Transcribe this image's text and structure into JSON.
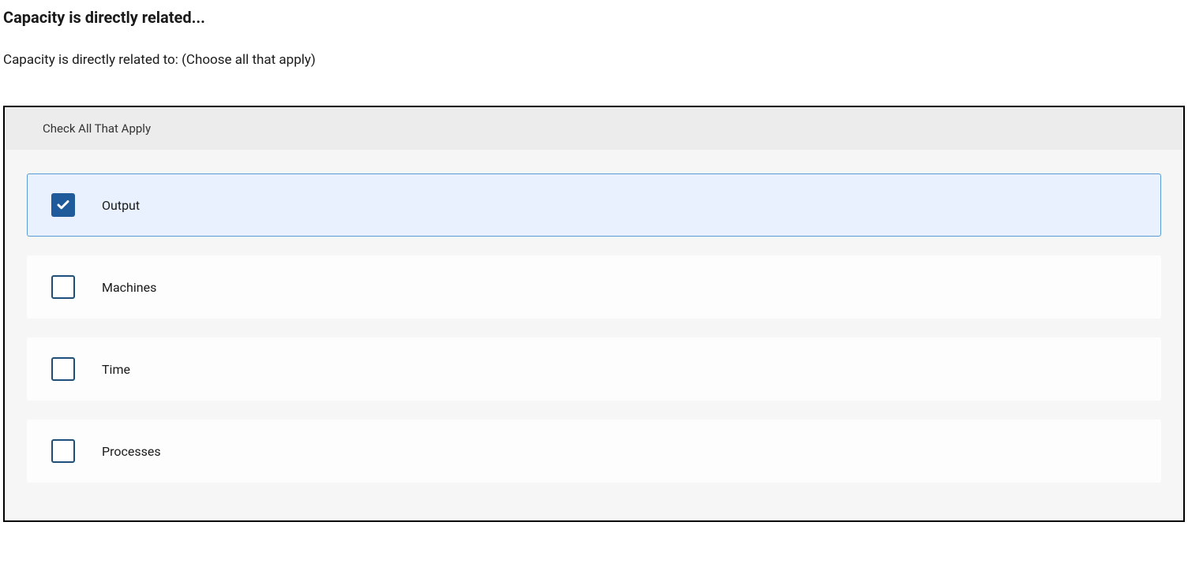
{
  "question": {
    "title": "Capacity is directly related...",
    "prompt": "Capacity is directly related to: (Choose all that apply)"
  },
  "panel": {
    "header": "Check All That Apply"
  },
  "options": [
    {
      "label": "Output",
      "checked": true
    },
    {
      "label": "Machines",
      "checked": false
    },
    {
      "label": "Time",
      "checked": false
    },
    {
      "label": "Processes",
      "checked": false
    }
  ]
}
